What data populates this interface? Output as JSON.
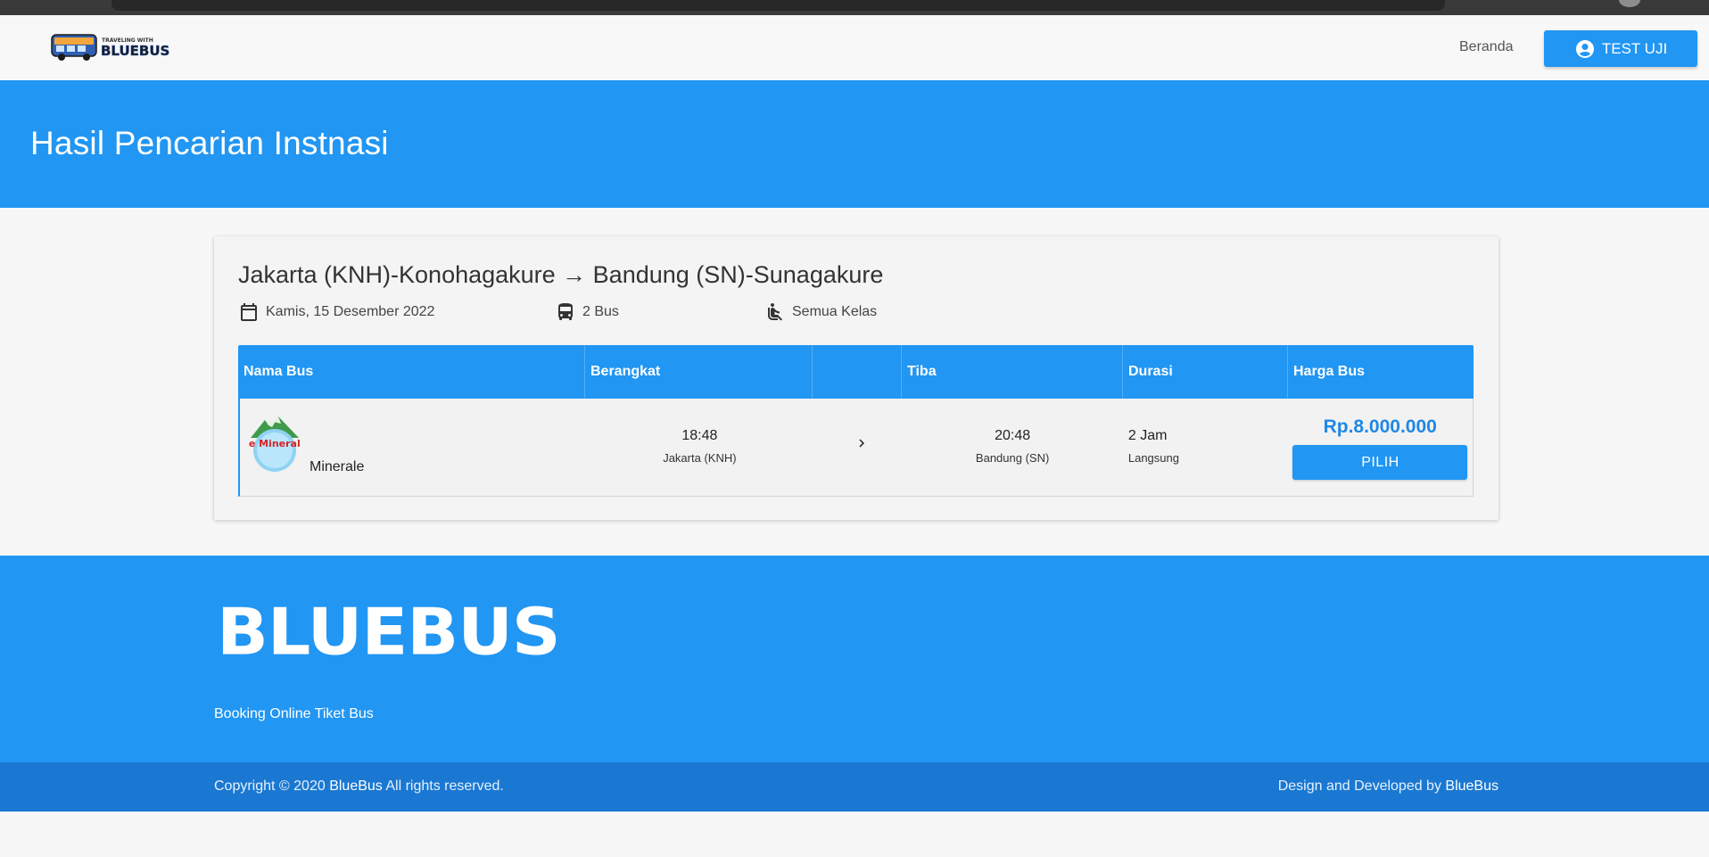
{
  "navbar": {
    "logo_text": "TRAVELING WITH BLUEBUS",
    "home_link": "Beranda",
    "user_button": "TEST UJI"
  },
  "hero": {
    "title": "Hasil Pencarian Instnasi"
  },
  "search": {
    "route": "Jakarta (KNH)-Konohagakure → Bandung (SN)-Sunagakure",
    "date": "Kamis, 15 Desember 2022",
    "bus_count": "2 Bus",
    "class": "Semua Kelas"
  },
  "table": {
    "headers": [
      "Nama Bus",
      "Berangkat",
      "",
      "Tiba",
      "Durasi",
      "Harga Bus"
    ],
    "rows": [
      {
        "bus_name": "Minerale",
        "bus_logo_text": "Le Minerale",
        "depart_time": "18:48",
        "depart_place": "Jakarta (KNH)",
        "arrive_time": "20:48",
        "arrive_place": "Bandung (SN)",
        "duration": "2 Jam",
        "duration_type": "Langsung",
        "price": "Rp.8.000.000",
        "action": "PILIH"
      }
    ]
  },
  "footer": {
    "brand": "BLUEBUS",
    "tagline": "Booking Online Tiket Bus",
    "copyright_prefix": "Copyright © 2020 ",
    "copyright_brand": "BlueBus",
    "copyright_suffix": " All rights reserved.",
    "credit_prefix": "Design and Developed by ",
    "credit_brand": "BlueBus"
  },
  "colors": {
    "primary": "#2196f3",
    "primary_dark": "#1a78d2",
    "price": "#1e88e5"
  }
}
